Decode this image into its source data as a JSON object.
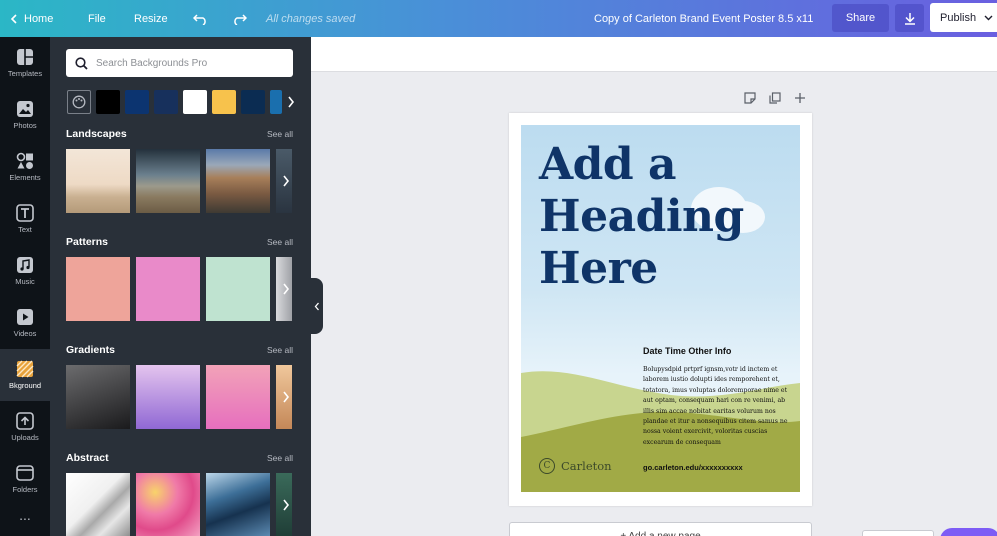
{
  "topbar": {
    "home_label": "Home",
    "file_label": "File",
    "resize_label": "Resize",
    "saved_status": "All changes saved",
    "doc_title": "Copy of Carleton Brand Event Poster 8.5 x11",
    "share_label": "Share",
    "publish_label": "Publish"
  },
  "rail": {
    "items": [
      {
        "label": "Templates",
        "icon": "templates-icon"
      },
      {
        "label": "Photos",
        "icon": "photos-icon"
      },
      {
        "label": "Elements",
        "icon": "elements-icon"
      },
      {
        "label": "Text",
        "icon": "text-icon"
      },
      {
        "label": "Music",
        "icon": "music-icon"
      },
      {
        "label": "Videos",
        "icon": "videos-icon"
      },
      {
        "label": "Bkground",
        "icon": "background-icon"
      },
      {
        "label": "Uploads",
        "icon": "uploads-icon"
      },
      {
        "label": "Folders",
        "icon": "folders-icon"
      }
    ],
    "more_label": "..."
  },
  "panel": {
    "search_placeholder": "Search Backgrounds Pro",
    "swatch_colors": [
      "#000000",
      "#0c3470",
      "#17305c",
      "#ffffff",
      "#f7c24c",
      "#0b2c52",
      "#1a6fae"
    ],
    "see_all": "See all",
    "sections": [
      {
        "title": "Landscapes"
      },
      {
        "title": "Patterns"
      },
      {
        "title": "Gradients"
      },
      {
        "title": "Abstract"
      }
    ]
  },
  "poster": {
    "headline": "Add a Heading Here",
    "info_title": "Date Time Other Info",
    "info_body": "Bolupysdpid prtprf ignsm,votr id inctem et laborem iustio dolupti ides remporehent et, totatora, imus voluptas doloremporae nime et aut optam, consequam hari con re venimi, ab illis sim accae nobitat earitas volurum nos plandae et itur a nonsequibus citem samus ne nossa voient exercivit, voloritas cuscias excearum de consequam",
    "logo_text": "Carleton",
    "url": "go.carleton.edu/xxxxxxxxxx"
  },
  "add_page_label": "+ Add a new page"
}
